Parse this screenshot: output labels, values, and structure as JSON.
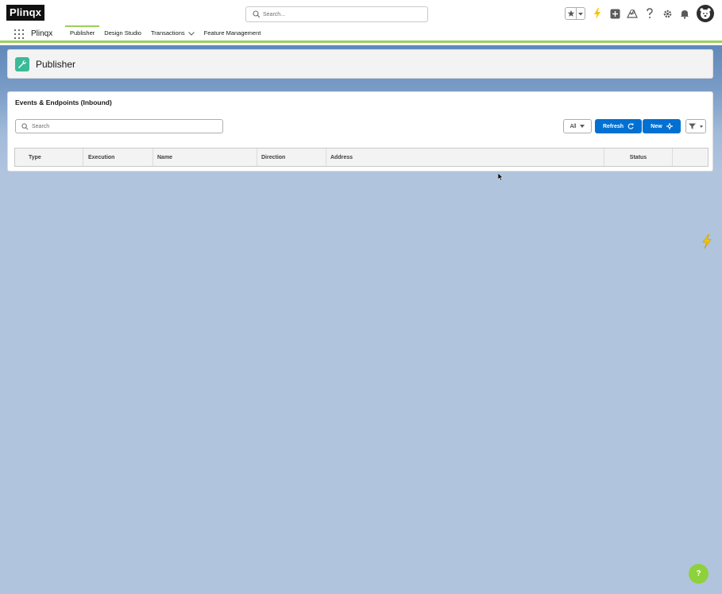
{
  "header": {
    "logo": "Plinqx",
    "search_placeholder": "Search...",
    "icons": [
      "favorites-star-icon",
      "favorites-caret-icon",
      "lightning-icon",
      "add-icon",
      "trailhead-icon",
      "help-icon",
      "setup-gear-icon",
      "notification-bell-icon",
      "user-avatar-icon"
    ]
  },
  "nav": {
    "app_name": "Plinqx",
    "items": [
      {
        "label": "Publisher",
        "active": true
      },
      {
        "label": "Design Studio",
        "active": false
      },
      {
        "label": "Transactions",
        "active": false,
        "dropdown": true
      },
      {
        "label": "Feature Management",
        "active": false
      }
    ]
  },
  "page_header": {
    "title": "Publisher",
    "icon": "wrench-icon"
  },
  "card": {
    "title": "Events & Endpoints (Inbound)",
    "search_placeholder": "Search",
    "filter_select": "All",
    "refresh_label": "Refresh",
    "new_label": "New",
    "columns": [
      "Type",
      "Execution",
      "Name",
      "Direction",
      "Address",
      "Status"
    ]
  },
  "colors": {
    "brand_button": "#0070d2",
    "nav_accent": "#9ad05a",
    "page_background": "#b0c4de",
    "header_icon_bg": "#3bba98",
    "help_fab": "#8ed13c"
  },
  "help_fab_label": "?"
}
